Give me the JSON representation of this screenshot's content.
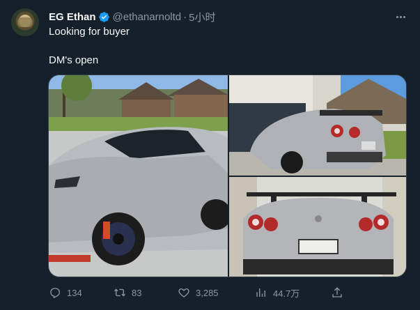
{
  "tweet": {
    "display_name": "EG Ethan",
    "handle": "@ethanarnoltd",
    "separator": "·",
    "time": "5小时",
    "text_line1": "Looking for buyer",
    "text_line2": "DM's open"
  },
  "metrics": {
    "replies": "134",
    "retweets": "83",
    "likes": "3,285",
    "views": "44.7万"
  },
  "colors": {
    "background": "#15202b",
    "verified": "#1d9bf0",
    "muted": "#8b98a5"
  },
  "icons": {
    "reply": "reply-icon",
    "retweet": "retweet-icon",
    "like": "heart-icon",
    "views": "views-icon",
    "share": "share-icon",
    "more": "more-icon",
    "verified": "verified-icon"
  }
}
